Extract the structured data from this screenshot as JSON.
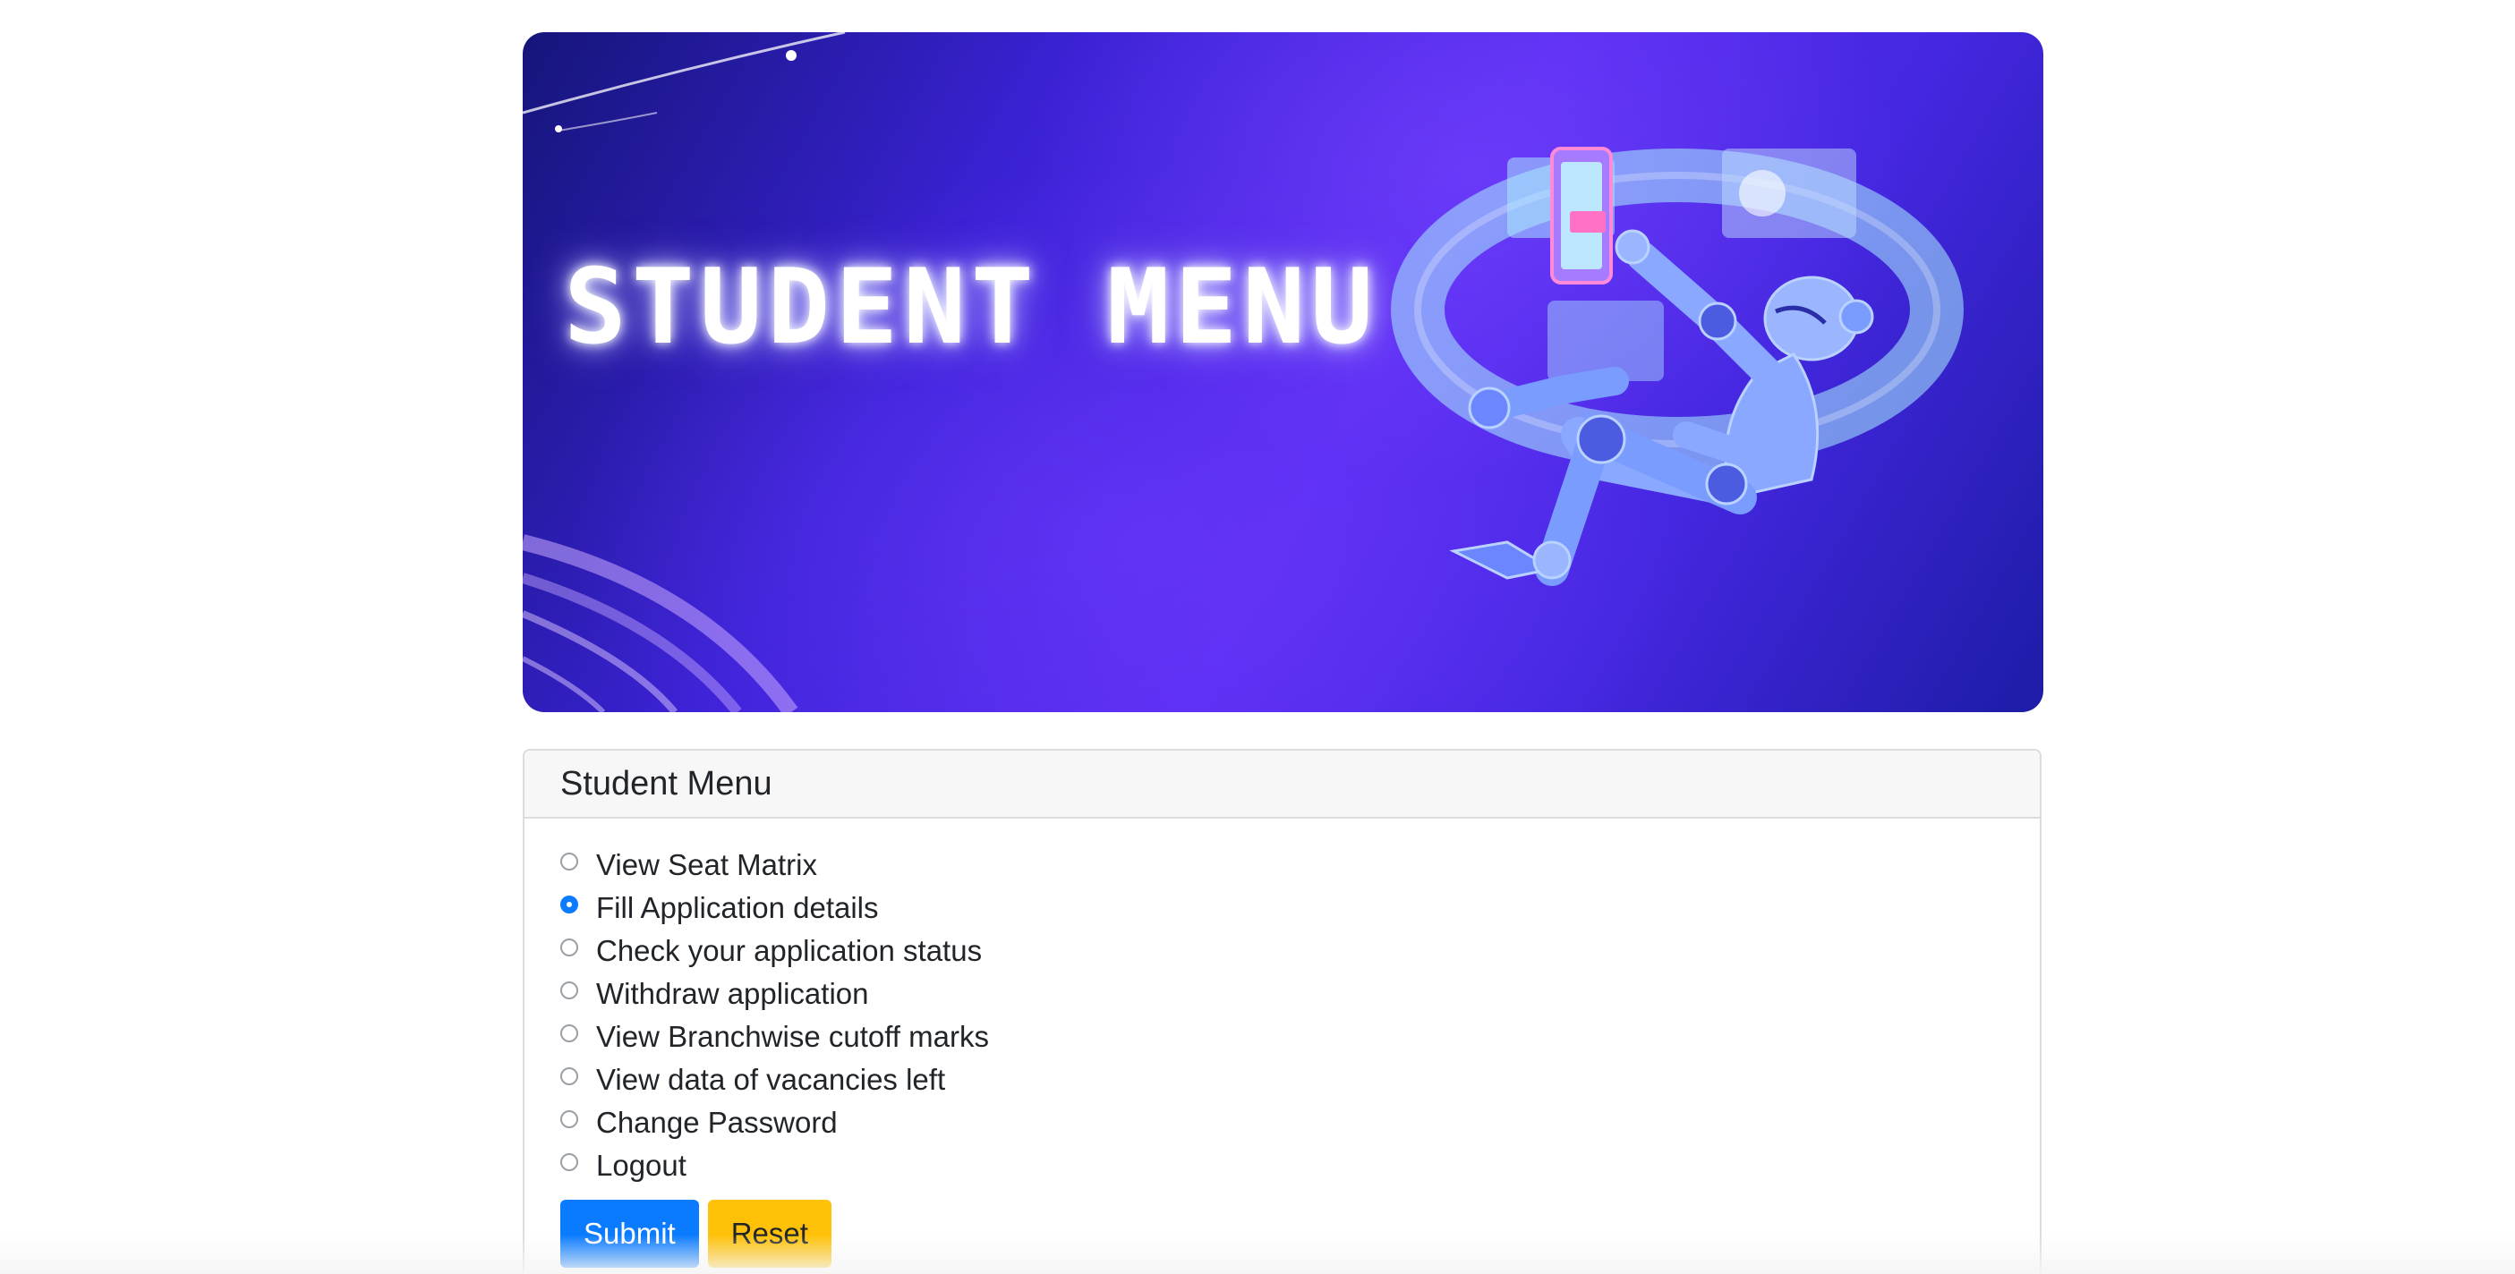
{
  "banner": {
    "title": "STUDENT MENU"
  },
  "menu": {
    "header": "Student Menu",
    "options": [
      {
        "label": "View Seat Matrix",
        "checked": false
      },
      {
        "label": "Fill Application details",
        "checked": true
      },
      {
        "label": "Check your application status",
        "checked": false
      },
      {
        "label": "Withdraw application",
        "checked": false
      },
      {
        "label": "View Branchwise cutoff marks",
        "checked": false
      },
      {
        "label": "View data of vacancies left",
        "checked": false
      },
      {
        "label": "Change Password",
        "checked": false
      },
      {
        "label": "Logout",
        "checked": false
      }
    ],
    "submit_label": "Submit",
    "reset_label": "Reset"
  },
  "colors": {
    "primary": "#0a7bff",
    "warning": "#ffc107",
    "banner_purple": "#5a2cf2"
  }
}
